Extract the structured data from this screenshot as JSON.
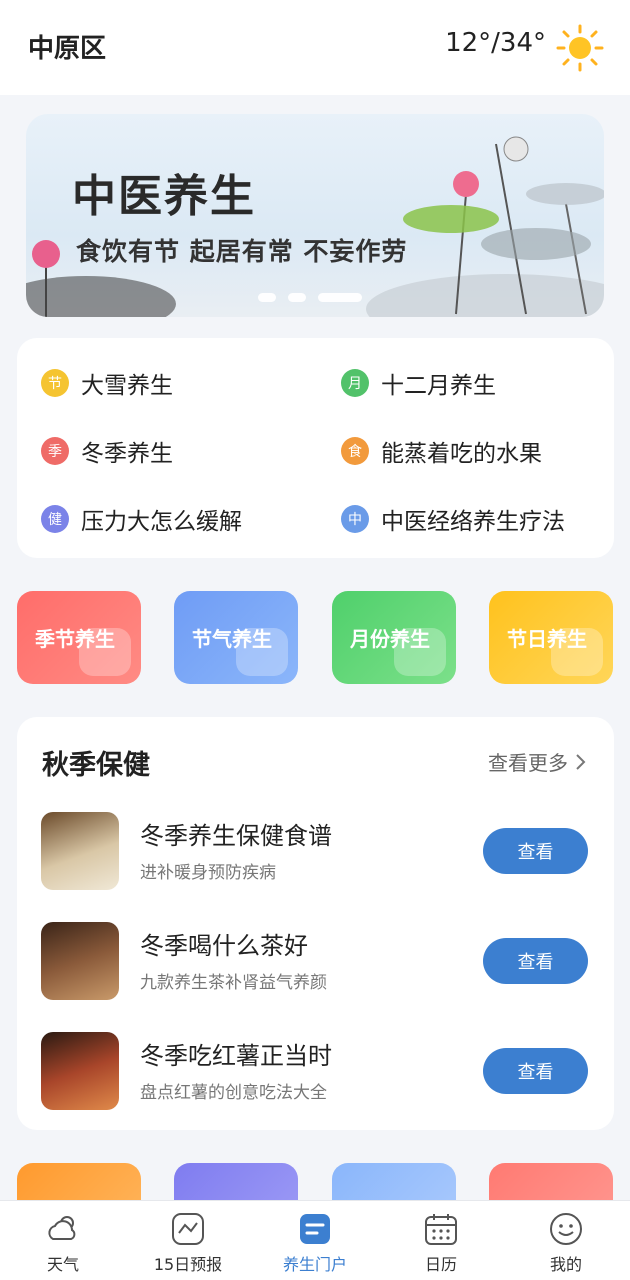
{
  "header": {
    "location": "中原区",
    "temperature": "12°/34°",
    "weather_icon": "sun-icon"
  },
  "banner": {
    "title": "中医养生",
    "subtitle": "食饮有节 起居有常 不妄作劳",
    "slides": 3,
    "active_slide": 3
  },
  "topics": [
    {
      "badge": "节",
      "label": "大雪养生",
      "color": "#f5c431"
    },
    {
      "badge": "月",
      "label": "十二月养生",
      "color": "#52c26a"
    },
    {
      "badge": "季",
      "label": "冬季养生",
      "color": "#ef6b67"
    },
    {
      "badge": "食",
      "label": "能蒸着吃的水果",
      "color": "#f29a3c"
    },
    {
      "badge": "健",
      "label": "压力大怎么缓解",
      "color": "#7b83e8"
    },
    {
      "badge": "中",
      "label": "中医经络养生疗法",
      "color": "#6a9be8"
    }
  ],
  "categories": [
    {
      "label": "季节养生",
      "from": "#ff6d6a",
      "to": "#ff8b84"
    },
    {
      "label": "节气养生",
      "from": "#6f9cf5",
      "to": "#8bb6fa"
    },
    {
      "label": "月份养生",
      "from": "#4fd06b",
      "to": "#7ce08a"
    },
    {
      "label": "节日养生",
      "from": "#ffc21d",
      "to": "#ffd659"
    }
  ],
  "section": {
    "title": "秋季保健",
    "more_label": "查看更多",
    "items": [
      {
        "title": "冬季养生保健食谱",
        "desc": "进补暖身预防疾病",
        "button": "查看"
      },
      {
        "title": "冬季喝什么茶好",
        "desc": "九款养生茶补肾益气养颜",
        "button": "查看"
      },
      {
        "title": "冬季吃红薯正当时",
        "desc": "盘点红薯的创意吃法大全",
        "button": "查看"
      }
    ]
  },
  "peek_colors": [
    "#ff9a2e",
    "#7f7cf0",
    "#8ab6fb",
    "#ff7a72"
  ],
  "tabbar": [
    {
      "label": "天气",
      "icon": "cloud-sun-icon"
    },
    {
      "label": "15日预报",
      "icon": "trend-chart-icon"
    },
    {
      "label": "养生门户",
      "icon": "document-icon"
    },
    {
      "label": "日历",
      "icon": "calendar-icon"
    },
    {
      "label": "我的",
      "icon": "smiley-icon"
    }
  ],
  "active_tab": "养生门户"
}
